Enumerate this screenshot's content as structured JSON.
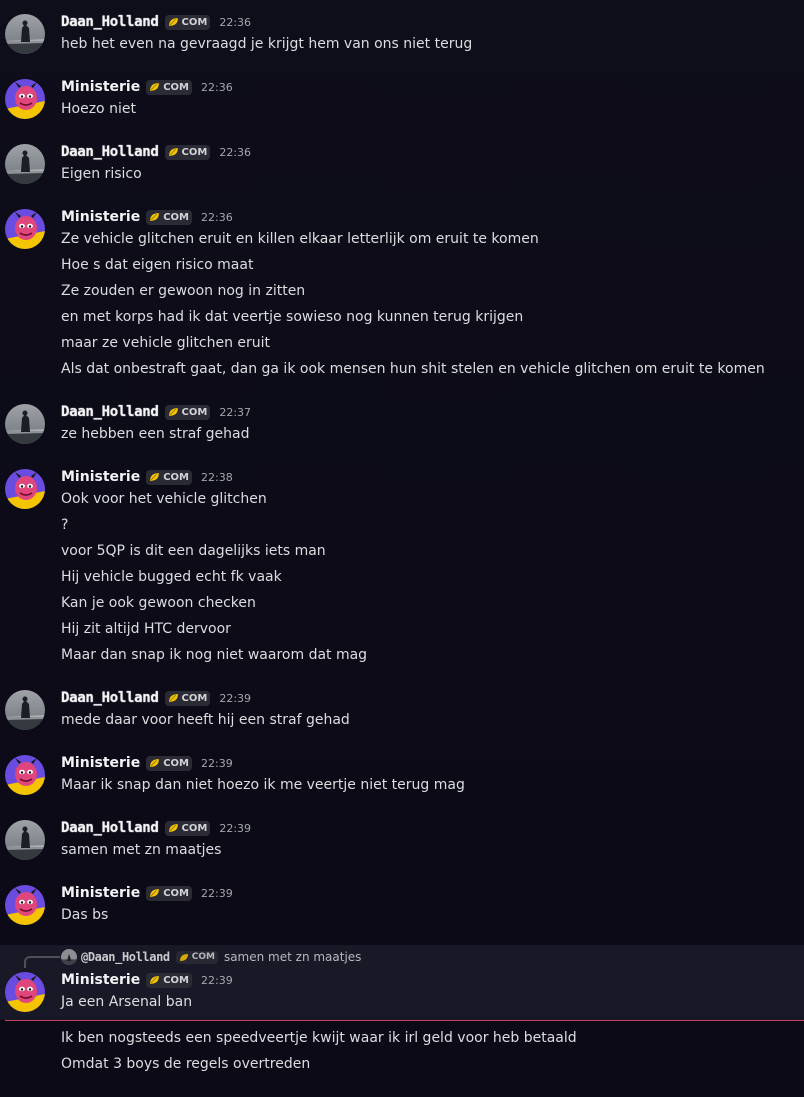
{
  "users": {
    "daan": {
      "name": "Daan_Holland",
      "tag": "COM"
    },
    "min": {
      "name": "Ministerie",
      "tag": "COM"
    }
  },
  "colors": {
    "divider": "#c2445f",
    "tag_icon": "#f5c400",
    "min_avatar_bg": "#6a4ce0",
    "daan_avatar_bg": "#5a6470"
  },
  "messages": [
    {
      "author": "Daan_Holland",
      "tag": "COM",
      "time": "22:36",
      "lines": [
        "heb het even na gevraagd je krijgt hem van ons niet terug"
      ]
    },
    {
      "author": "Ministerie",
      "tag": "COM",
      "time": "22:36",
      "lines": [
        "Hoezo niet"
      ]
    },
    {
      "author": "Daan_Holland",
      "tag": "COM",
      "time": "22:36",
      "lines": [
        "Eigen risico"
      ]
    },
    {
      "author": "Ministerie",
      "tag": "COM",
      "time": "22:36",
      "lines": [
        "Ze vehicle glitchen eruit en killen elkaar letterlijk om eruit te komen",
        "Hoe s dat eigen risico maat",
        "Ze zouden er gewoon nog in zitten",
        "en met korps had ik dat veertje sowieso nog kunnen terug krijgen",
        "maar ze vehicle glitchen eruit",
        "Als dat onbestraft gaat, dan ga ik ook mensen hun shit stelen en vehicle glitchen om eruit te komen"
      ]
    },
    {
      "author": "Daan_Holland",
      "tag": "COM",
      "time": "22:37",
      "lines": [
        "ze hebben een straf gehad"
      ]
    },
    {
      "author": "Ministerie",
      "tag": "COM",
      "time": "22:38",
      "lines": [
        "Ook voor het vehicle glitchen",
        "?",
        "voor 5QP is dit een dagelijks iets man",
        "Hij vehicle bugged echt fk vaak",
        "Kan je ook gewoon checken",
        "Hij zit altijd HTC dervoor",
        "Maar dan snap ik nog niet waarom dat mag"
      ]
    },
    {
      "author": "Daan_Holland",
      "tag": "COM",
      "time": "22:39",
      "lines": [
        "mede daar voor heeft hij een straf gehad"
      ]
    },
    {
      "author": "Ministerie",
      "tag": "COM",
      "time": "22:39",
      "lines": [
        "Maar ik snap dan niet hoezo ik me veertje niet terug mag"
      ]
    },
    {
      "author": "Daan_Holland",
      "tag": "COM",
      "time": "22:39",
      "lines": [
        "samen met zn maatjes"
      ]
    },
    {
      "author": "Ministerie",
      "tag": "COM",
      "time": "22:39",
      "lines": [
        "Das bs"
      ]
    },
    {
      "author": "Ministerie",
      "tag": "COM",
      "time": "22:39",
      "lines": [
        "Ja een Arsenal ban"
      ]
    }
  ],
  "reply": {
    "name": "@Daan_Holland",
    "tag": "COM",
    "text": "samen met zn maatjes"
  },
  "after_divider": [
    "Ik ben nogsteeds een speedveertje kwijt waar ik irl geld voor heb betaald",
    "Omdat 3 boys de regels overtreden"
  ]
}
